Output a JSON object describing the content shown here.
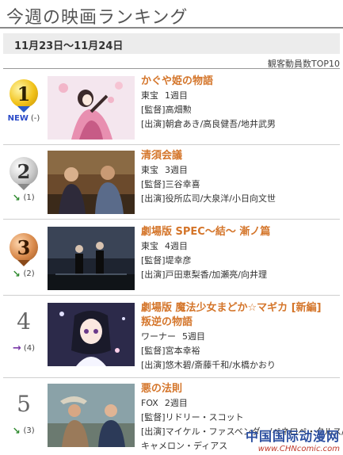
{
  "page": {
    "title": "今週の映画ランキング",
    "date_range": "11月23日〜11月24日",
    "basis": "観客動員数TOP10"
  },
  "entries": [
    {
      "rank": "1",
      "change": "(-)",
      "new_label": "NEW",
      "title": "かぐや姫の物語",
      "title_cont": "",
      "studio": "東宝",
      "weeks": "1週目",
      "director": "[監督]高畑勲",
      "cast": "[出演]朝倉あき/高良健吾/地井武男",
      "cast_cont": ""
    },
    {
      "rank": "2",
      "change": "(1)",
      "title": "清須会議",
      "title_cont": "",
      "studio": "東宝",
      "weeks": "3週目",
      "director": "[監督]三谷幸喜",
      "cast": "[出演]役所広司/大泉洋/小日向文世",
      "cast_cont": ""
    },
    {
      "rank": "3",
      "change": "(2)",
      "title": "劇場版 SPEC〜結〜 漸ノ篇",
      "title_cont": "",
      "studio": "東宝",
      "weeks": "4週目",
      "director": "[監督]堤幸彦",
      "cast": "[出演]戸田恵梨香/加瀬亮/向井理",
      "cast_cont": ""
    },
    {
      "rank": "4",
      "change": "(4)",
      "title": "劇場版 魔法少女まどか☆マギカ [新編]",
      "title_cont": "叛逆の物語",
      "studio": "ワーナー",
      "weeks": "5週目",
      "director": "[監督]宮本幸裕",
      "cast": "[出演]悠木碧/斎藤千和/水橋かおり",
      "cast_cont": ""
    },
    {
      "rank": "5",
      "change": "(3)",
      "title": "悪の法則",
      "title_cont": "",
      "studio": "FOX",
      "weeks": "2週目",
      "director": "[監督]リドリー・スコット",
      "cast": "[出演]マイケル・ファスベンダー/ペネロペ・クルス/",
      "cast_cont": "キャメロン・ディアス"
    }
  ],
  "watermark": {
    "main": "中国国际动漫网",
    "sub": "www.CHNcomic.com"
  },
  "colors": {
    "title_accent": "#d4752a",
    "gold": "#f1c21b",
    "silver": "#c9c9c9",
    "bronze": "#d98a4c",
    "down_arrow": "#2f8a2f",
    "steady_arrow": "#7a3aa8"
  }
}
